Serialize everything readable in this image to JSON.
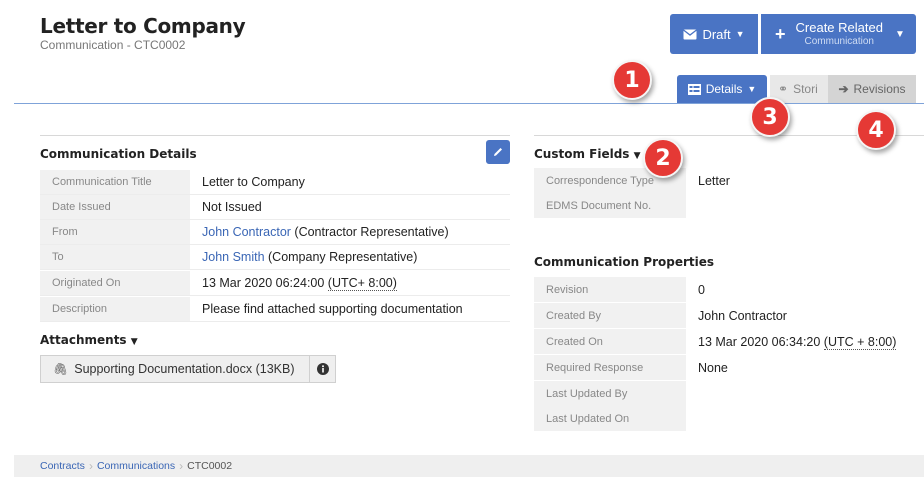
{
  "header": {
    "title": "Letter to Company",
    "subtitle": "Communication - CTC0002",
    "draft_label": "Draft",
    "create_label": "Create Related",
    "create_sublabel": "Communication"
  },
  "tabs": {
    "details": "Details",
    "stories": "Stori",
    "revisions": "Revisions"
  },
  "badges": [
    "1",
    "2",
    "3",
    "4"
  ],
  "communication_details": {
    "title": "Communication Details",
    "rows": [
      {
        "label": "Communication Title",
        "value": "Letter to Company"
      },
      {
        "label": "Date Issued",
        "value": "Not Issued"
      },
      {
        "label": "From",
        "link": "John Contractor",
        "suffix": " (Contractor Representative)"
      },
      {
        "label": "To",
        "link": "John Smith",
        "suffix": " (Company Representative)"
      },
      {
        "label": "Originated On",
        "value": "13 Mar 2020 06:24:00 ",
        "tz": "(UTC+ 8:00)"
      },
      {
        "label": "Description",
        "value": "Please find attached supporting documentation"
      }
    ]
  },
  "attachments": {
    "title": "Attachments",
    "file": "Supporting Documentation.docx (13KB)"
  },
  "custom_fields": {
    "title": "Custom Fields",
    "rows": [
      {
        "label": "Correspondence Type",
        "value": "Letter"
      },
      {
        "label": "EDMS Document No.",
        "value": ""
      }
    ]
  },
  "properties": {
    "title": "Communication Properties",
    "rows": [
      {
        "label": "Revision",
        "value": "0"
      },
      {
        "label": "Created By",
        "link": "John Contractor"
      },
      {
        "label": "Created On",
        "value": "13 Mar 2020 06:34:20 ",
        "tz": "(UTC + 8:00)"
      },
      {
        "label": "Required Response",
        "value": "None"
      },
      {
        "label": "Last Updated By",
        "value": ""
      },
      {
        "label": "Last Updated On",
        "value": ""
      }
    ]
  },
  "breadcrumb": {
    "items": [
      "Contracts",
      "Communications",
      "CTC0002"
    ]
  },
  "colors": {
    "primary": "#4a74c4",
    "badge": "#e53935",
    "link": "#3a66b5"
  }
}
